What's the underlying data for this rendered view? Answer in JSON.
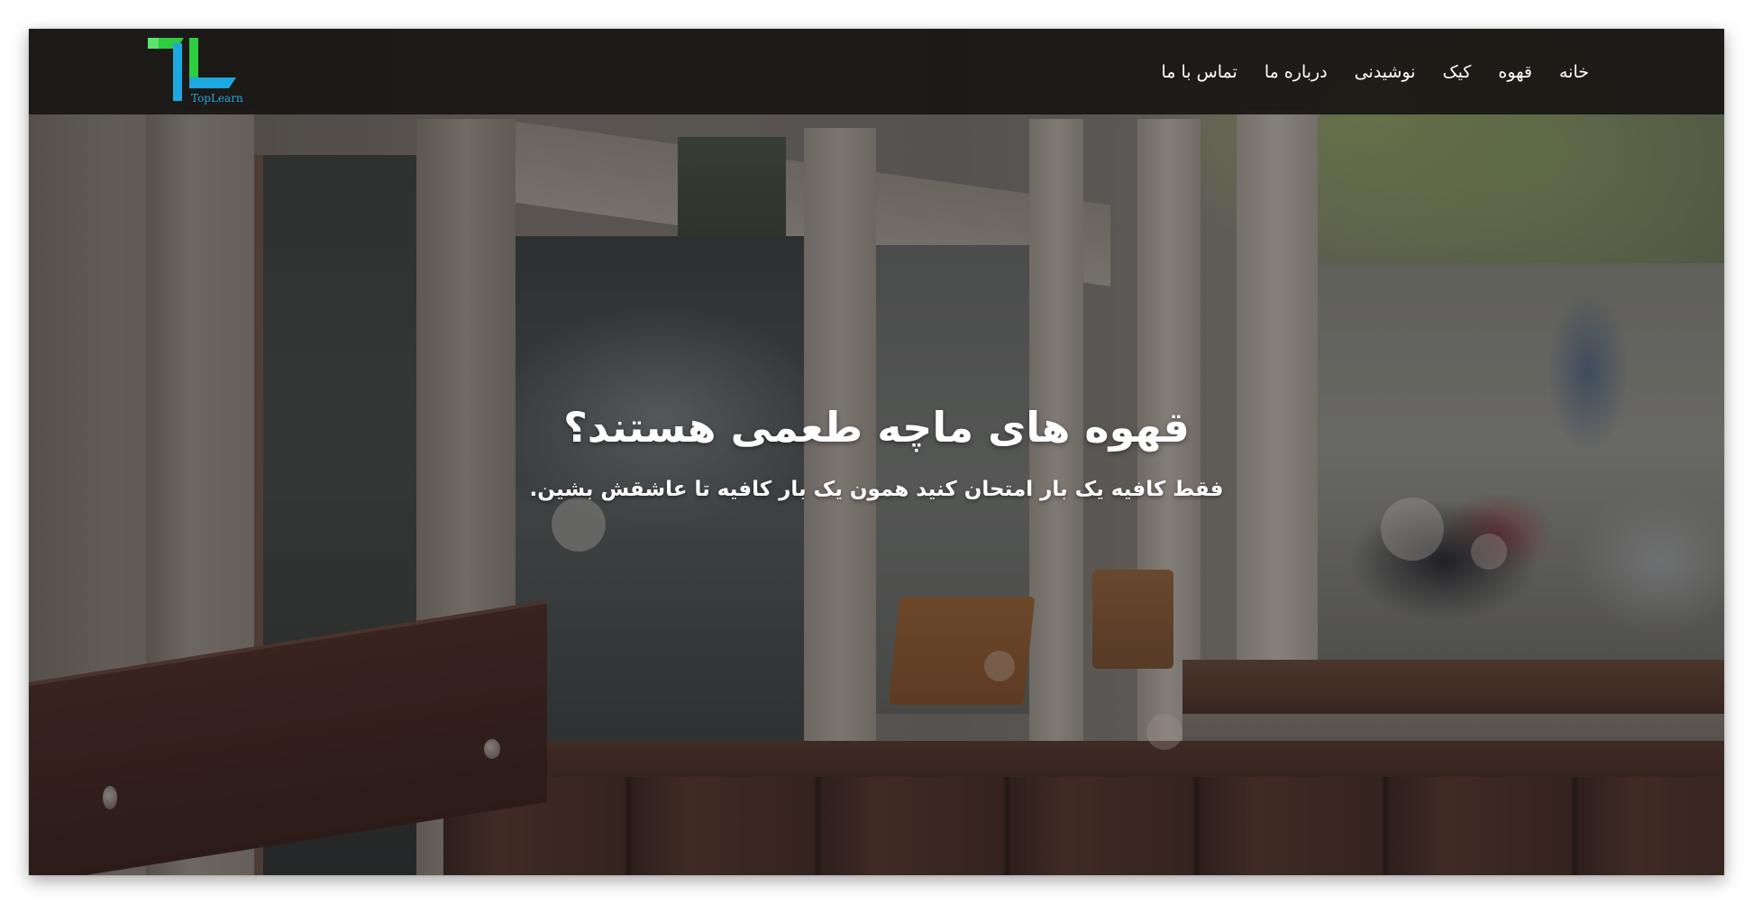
{
  "brand": {
    "logo_text": "TopLearn",
    "colors": {
      "logo_green": "#2ecc40",
      "logo_blue": "#1ea8e0",
      "navbar_bg": "#181614"
    }
  },
  "nav": {
    "items": [
      {
        "label": "خانه"
      },
      {
        "label": "قهوه"
      },
      {
        "label": "کیک"
      },
      {
        "label": "نوشیدنی"
      },
      {
        "label": "درباره ما"
      },
      {
        "label": "تماس با ما"
      }
    ]
  },
  "hero": {
    "title": "قهوه های ماچه طعمی هستند؟",
    "subtitle": "فقط کافیه یک بار امتحان کنید همون یک بار کافیه تا عاشقش بشین."
  }
}
